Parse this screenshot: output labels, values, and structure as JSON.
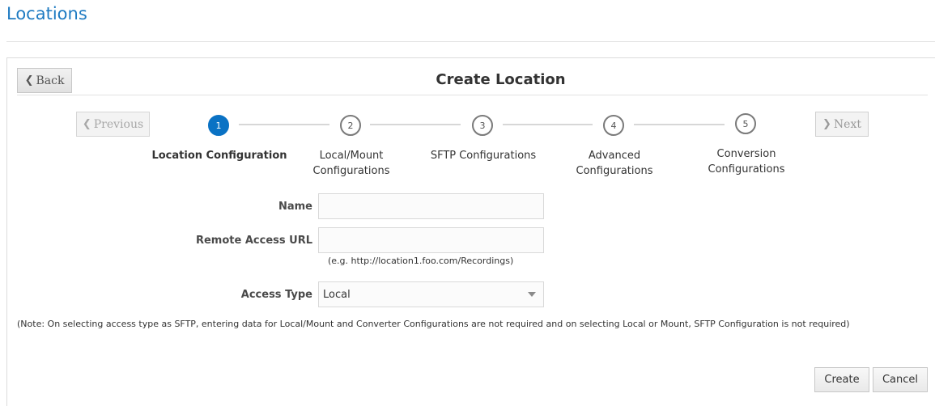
{
  "page": {
    "title": "Locations"
  },
  "dialog": {
    "back_label": "Back",
    "title": "Create Location",
    "previous_label": "Previous",
    "next_label": "Next"
  },
  "train": {
    "current_step": 1,
    "steps": [
      {
        "number": "1",
        "label_line1": "Location Configuration",
        "label_line2": ""
      },
      {
        "number": "2",
        "label_line1": "Local/Mount",
        "label_line2": "Configurations"
      },
      {
        "number": "3",
        "label_line1": "SFTP Configurations",
        "label_line2": ""
      },
      {
        "number": "4",
        "label_line1": "Advanced",
        "label_line2": "Configurations"
      },
      {
        "number": "5",
        "label_line1": "Conversion",
        "label_line2": "Configurations"
      }
    ]
  },
  "form": {
    "name_label": "Name",
    "name_value": "",
    "url_label": "Remote Access URL",
    "url_value": "",
    "url_hint": "(e.g. http://location1.foo.com/Recordings)",
    "access_type_label": "Access Type",
    "access_type_value": "Local",
    "note": "(Note: On selecting access type as SFTP, entering data for Local/Mount and Converter Configurations are not required and on selecting Local or Mount, SFTP Configuration is not required)"
  },
  "actions": {
    "create_label": "Create",
    "cancel_label": "Cancel"
  },
  "colors": {
    "accent": "#0a72c4",
    "title": "#1f7bc2"
  }
}
